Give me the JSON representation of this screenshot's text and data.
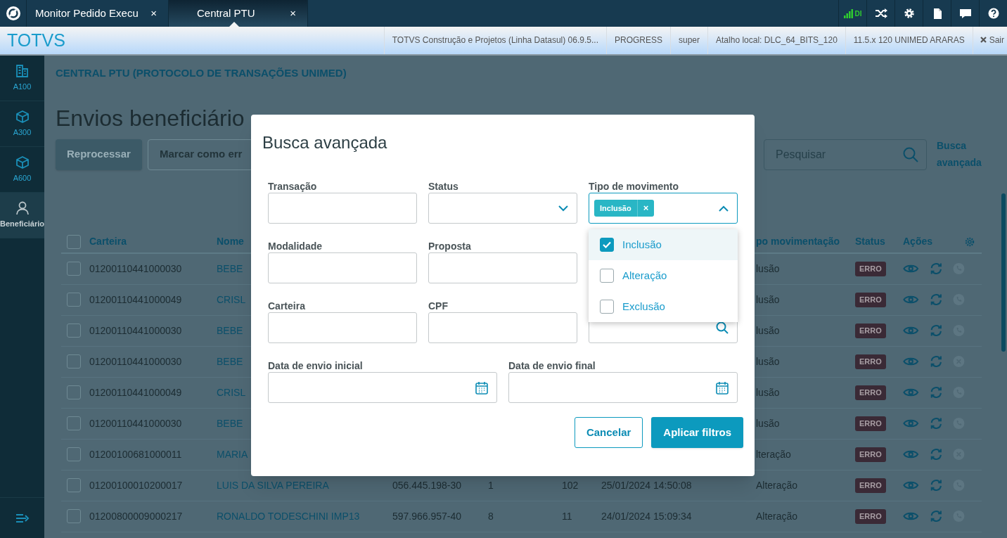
{
  "tabs": [
    {
      "label": "Monitor Pedido Execu",
      "close": "×",
      "selected": false
    },
    {
      "label": "Central PTU",
      "close": "×",
      "selected": true
    }
  ],
  "connection": {
    "label": "DI"
  },
  "header_bar": {
    "brand": "TOTVS",
    "info": [
      "TOTVS Construção e Projetos (Linha Datasul) 06.9.5...",
      "PROGRESS",
      "super",
      "Atalho local: DLC_64_BITS_120",
      "11.5.x 120 UNIMED ARARAS"
    ],
    "logout": "Sair"
  },
  "sidebar": {
    "items": [
      {
        "label": "A100",
        "kind": "building",
        "selected": false
      },
      {
        "label": "A300",
        "kind": "cube",
        "selected": false
      },
      {
        "label": "A600",
        "kind": "cube",
        "selected": false
      },
      {
        "label": "Beneficiário",
        "kind": "person",
        "selected": true
      }
    ]
  },
  "breadcrumb": "CENTRAL PTU (PROTOCOLO DE TRANSAÇÕES UNIMED)",
  "page_title": "Envios beneficiário",
  "actions": [
    {
      "label": "Reprocessar",
      "kind": "primary"
    },
    {
      "label": "Marcar como err",
      "kind": "secondary"
    }
  ],
  "search": {
    "placeholder": "Pesquisar"
  },
  "advanced_link": "Busca avançada",
  "table": {
    "all_checked": false,
    "headers": {
      "carteira": "Carteira",
      "nome": "Nome",
      "tipo": "po movimentação",
      "status": "Status",
      "acoes": "Ações"
    },
    "rows": [
      {
        "kind": "phone",
        "checked": false,
        "carteira": "01200110441000030",
        "nome": "BEBE",
        "tipo": "lusão",
        "status": "ERRO"
      },
      {
        "kind": "phone",
        "checked": false,
        "carteira": "01200110441000049",
        "nome": "CRISL",
        "tipo": "lusão",
        "status": "ERRO"
      },
      {
        "kind": "phone",
        "checked": false,
        "carteira": "01200110441000030",
        "nome": "BEBE",
        "tipo": "lusão",
        "status": "ERRO"
      },
      {
        "kind": "cancel",
        "checked": false,
        "carteira": "01200110441000030",
        "nome": "BEBE",
        "tipo": "lusão",
        "status": "ERRO"
      },
      {
        "kind": "phone",
        "checked": false,
        "carteira": "01200110441000049",
        "nome": "CRISL",
        "tipo": "lusão",
        "status": "ERRO"
      },
      {
        "kind": "phone",
        "checked": false,
        "carteira": "01200110441000030",
        "nome": "BEBE",
        "tipo": "lusão",
        "status": "ERRO"
      },
      {
        "kind": "cancel",
        "checked": false,
        "carteira": "01200100681000011",
        "nome": "MARIA",
        "tipo": "lteração",
        "status": "ERRO"
      },
      {
        "kind": "phone",
        "checked": false,
        "carteira": "01200100010200017",
        "nome": "LUIS DA SILVA PEREIRA",
        "cpf": "056.445.198-30",
        "column_4": "1",
        "column_5": "102",
        "data": "25/01/2024 14:50:08",
        "tipo": "Alteração",
        "status": "ERRO"
      },
      {
        "kind": "phone",
        "checked": false,
        "carteira": "01200800009000217",
        "nome": "RONALDO TODESCHINI IMP13",
        "cpf": "597.966.957-40",
        "column_4": "8",
        "column_5": "11",
        "data": "24/01/2024 15:09:34",
        "tipo": "Alteração",
        "status": "ERRO"
      }
    ]
  },
  "modal": {
    "title": "Busca avançada",
    "field_rows": [
      [
        {
          "label": "Transação",
          "kind": "text"
        },
        {
          "label": "Status",
          "kind": "select"
        },
        {
          "label": "Tipo de movimento",
          "kind": "multiselect",
          "expanded": true,
          "tags": [
            {
              "label": "Inclusão",
              "remove": "×"
            }
          ],
          "options": [
            {
              "label": "Inclusão",
              "checked": true
            },
            {
              "label": "Alteração",
              "checked": false
            },
            {
              "label": "Exclusão",
              "checked": false
            }
          ]
        }
      ],
      [
        {
          "label": "Modalidade",
          "kind": "text"
        },
        {
          "label": "Proposta",
          "kind": "text"
        },
        {
          "kind": "covered"
        }
      ],
      [
        {
          "label": "Carteira",
          "kind": "text"
        },
        {
          "label": "CPF",
          "kind": "text"
        },
        {
          "kind": "search"
        }
      ],
      [
        {
          "label": "Data de envio inicial",
          "kind": "date"
        },
        {
          "label": "Data de envio final",
          "kind": "date"
        }
      ]
    ],
    "buttons": [
      {
        "label": "Cancelar",
        "kind": "secondary"
      },
      {
        "label": "Aplicar filtros",
        "kind": "primary"
      }
    ]
  }
}
